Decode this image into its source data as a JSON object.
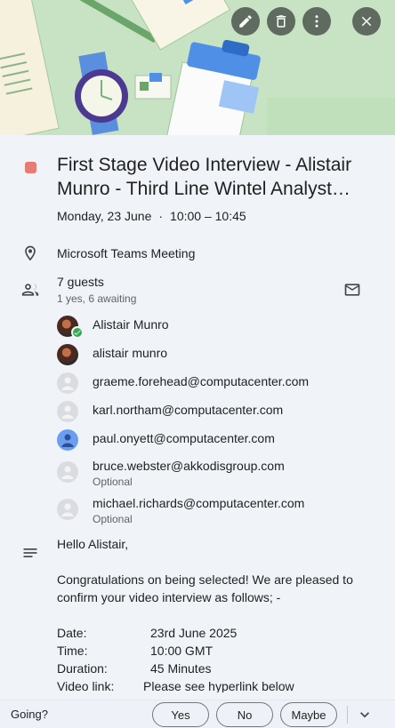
{
  "header": {
    "illustration": "desk-illustration",
    "actions": [
      {
        "name": "edit-button",
        "icon": "pencil-icon"
      },
      {
        "name": "delete-button",
        "icon": "trash-icon"
      },
      {
        "name": "more-options-button",
        "icon": "more-vertical-icon"
      },
      {
        "name": "close-button",
        "icon": "close-icon"
      }
    ]
  },
  "event": {
    "color": "#e67c73",
    "title": "First Stage Video Interview - Alistair Munro - Third Line Wintel Analyst…",
    "date": "Monday, 23 June",
    "separator": "·",
    "time": "10:00 – 10:45"
  },
  "location": {
    "icon": "location-pin-icon",
    "text": "Microsoft Teams Meeting"
  },
  "guests": {
    "icon": "people-icon",
    "title": "7 guests",
    "summary": "1 yes, 6 awaiting",
    "email_icon": "mail-icon",
    "list": [
      {
        "name": "Alistair Munro",
        "avatar": "photo",
        "badge": "check",
        "optional": ""
      },
      {
        "name": "alistair munro",
        "avatar": "photo",
        "badge": "",
        "optional": ""
      },
      {
        "name": "graeme.forehead@computacenter.com",
        "avatar": "grey",
        "badge": "",
        "optional": ""
      },
      {
        "name": "karl.northam@computacenter.com",
        "avatar": "grey",
        "badge": "",
        "optional": ""
      },
      {
        "name": "paul.onyett@computacenter.com",
        "avatar": "blue",
        "badge": "",
        "optional": ""
      },
      {
        "name": "bruce.webster@akkodisgroup.com",
        "avatar": "grey",
        "badge": "",
        "optional": "Optional"
      },
      {
        "name": "michael.richards@computacenter.com",
        "avatar": "grey",
        "badge": "",
        "optional": "Optional"
      }
    ]
  },
  "description": {
    "icon": "notes-icon",
    "greeting": "Hello Alistair,",
    "body": "Congratulations on being selected! We are pleased to confirm your video interview as follows; -",
    "details": [
      {
        "key": "Date:",
        "value": "23rd June 2025"
      },
      {
        "key": "Time:",
        "value": "10:00 GMT"
      },
      {
        "key": "Duration:",
        "value": "45 Minutes"
      },
      {
        "key": "Video link:",
        "value": "Please see hyperlink below"
      }
    ]
  },
  "footer": {
    "going_label": "Going?",
    "yes": "Yes",
    "no": "No",
    "maybe": "Maybe",
    "expand_icon": "chevron-down-icon"
  }
}
